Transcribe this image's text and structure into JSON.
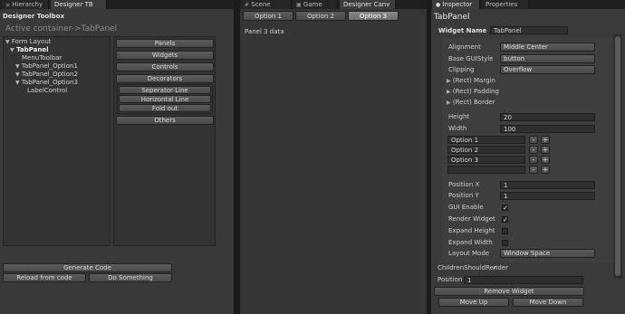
{
  "left": {
    "tabs": [
      "Hierarchy",
      "Designer TB"
    ],
    "title": "Designer Toolbox",
    "active_container": "Active container->TabPanel",
    "tree": [
      "Form Layout",
      "TabPanel",
      "MenuToolbar",
      "TabPanel_Option1",
      "TabPanel_Option2",
      "TabPanel_Option3",
      "LabelControl"
    ],
    "categories": {
      "panels": "Panels",
      "widgets": "Widgets",
      "controls": "Controls",
      "decorators": "Decorators",
      "decorator_items": [
        "Seperator Line",
        "Horizontal Line",
        "Fold out"
      ],
      "others": "Others"
    },
    "generate_code": "Generate Code",
    "reload": "Reload from code",
    "do_something": "Do Something"
  },
  "center": {
    "tabs": [
      "Scene",
      "Game",
      "Designer Canv"
    ],
    "option_tabs": [
      "Option 1",
      "Option 2",
      "Option 3"
    ],
    "panel_text": "Panel 3 data"
  },
  "right": {
    "tabs": [
      "Inspector",
      "Properties"
    ],
    "title": "TabPanel",
    "widget_name_label": "Widget Name",
    "widget_name_value": "TabPanel",
    "alignment_label": "Alignment",
    "alignment_value": "Middle Center",
    "base_style_label": "Base GUIStyle",
    "base_style_value": "button",
    "clipping_label": "Clipping",
    "clipping_value": "Overflow",
    "foldouts": [
      "(Rect) Margin",
      "(Rect) Padding",
      "(Rect) Border"
    ],
    "height_label": "Height",
    "height_value": "20",
    "width_label": "Width",
    "width_value": "100",
    "options": [
      "Option 1",
      "Option 2",
      "Option 3",
      ""
    ],
    "position_x_label": "Position X",
    "position_x_value": "1",
    "position_y_label": "Position Y",
    "position_y_value": "1",
    "gui_enable_label": "GUI Enable",
    "render_widget_label": "Render Widget",
    "expand_height_label": "Expand Height",
    "expand_width_label": "Expand Width",
    "layout_mode_label": "Layout Mode",
    "layout_mode_value": "Window Space",
    "children_label": "ChildrenShouldRender",
    "position_x2_label": "Position X",
    "position_x2_value": "1",
    "remove_widget": "Remove Widget",
    "move_up": "Move Up",
    "move_down": "Move Down",
    "minus": "-",
    "plus": "+",
    "check": "✓"
  }
}
